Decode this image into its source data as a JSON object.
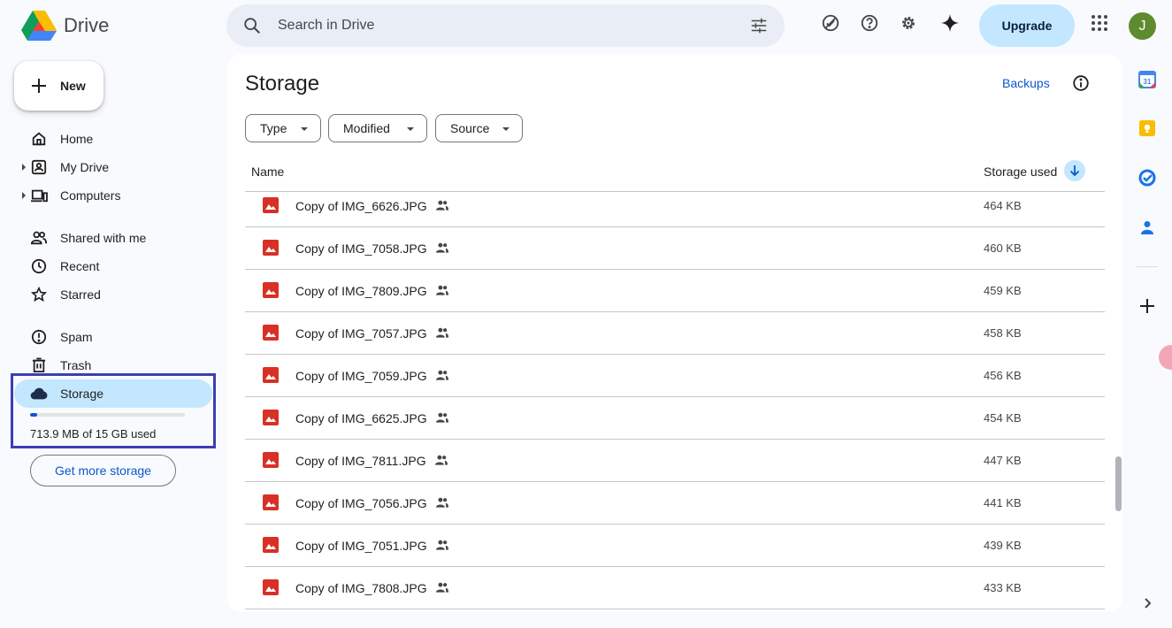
{
  "header": {
    "app_name": "Drive",
    "search_placeholder": "Search in Drive",
    "upgrade_label": "Upgrade",
    "avatar_initial": "J",
    "icons": [
      "search-icon",
      "search-options-icon",
      "ready-offline-icon",
      "help-icon",
      "settings-icon",
      "gemini-icon",
      "apps-icon"
    ]
  },
  "sidebar": {
    "new_label": "New",
    "items": [
      {
        "label": "Home",
        "icon": "home-icon"
      },
      {
        "label": "My Drive",
        "icon": "my-drive-icon"
      },
      {
        "label": "Computers",
        "icon": "computers-icon"
      },
      {
        "label": "Shared with me",
        "icon": "shared-icon"
      },
      {
        "label": "Recent",
        "icon": "recent-icon"
      },
      {
        "label": "Starred",
        "icon": "star-icon"
      },
      {
        "label": "Spam",
        "icon": "spam-icon"
      },
      {
        "label": "Trash",
        "icon": "trash-icon"
      },
      {
        "label": "Storage",
        "icon": "cloud-icon"
      }
    ],
    "storage_used_text": "713.9 MB of 15 GB used",
    "storage_fraction": 0.046,
    "get_more_storage_label": "Get more storage"
  },
  "main": {
    "title": "Storage",
    "backups_label": "Backups",
    "filters": [
      "Type",
      "Modified",
      "Source"
    ],
    "columns": {
      "name": "Name",
      "size": "Storage used"
    },
    "files": [
      {
        "name": "Copy of IMG_6626.JPG",
        "size": "464 KB"
      },
      {
        "name": "Copy of IMG_7058.JPG",
        "size": "460 KB"
      },
      {
        "name": "Copy of IMG_7809.JPG",
        "size": "459 KB"
      },
      {
        "name": "Copy of IMG_7057.JPG",
        "size": "458 KB"
      },
      {
        "name": "Copy of IMG_7059.JPG",
        "size": "456 KB"
      },
      {
        "name": "Copy of IMG_6625.JPG",
        "size": "454 KB"
      },
      {
        "name": "Copy of IMG_7811.JPG",
        "size": "447 KB"
      },
      {
        "name": "Copy of IMG_7056.JPG",
        "size": "441 KB"
      },
      {
        "name": "Copy of IMG_7051.JPG",
        "size": "439 KB"
      },
      {
        "name": "Copy of IMG_7808.JPG",
        "size": "433 KB"
      }
    ]
  },
  "side_rail": {
    "calendar_day": "31",
    "icons": [
      "calendar-icon",
      "keep-icon",
      "tasks-icon",
      "contacts-icon",
      "add-icon",
      "expand-icon"
    ]
  },
  "colors": {
    "accent": "#0b57d0",
    "active_bg": "#c2e7ff",
    "image_file": "#d93025"
  }
}
